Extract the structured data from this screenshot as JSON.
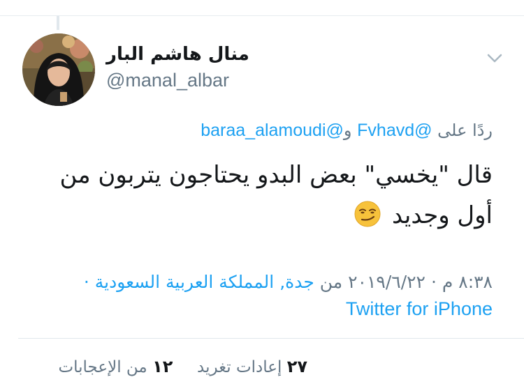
{
  "tweet": {
    "author": {
      "display_name": "منال هاشم البار",
      "handle": "@manal_albar"
    },
    "reply": {
      "prefix": "ردًا على",
      "mention_1": "@Fvhavd",
      "joiner": "و",
      "mention_2": "@baraa_alamoudi"
    },
    "text_line_1": "قال \"يخسي\" بعض البدو يحتاجون يتربون من",
    "text_line_2": "أول وجديد",
    "emoji": "smirking-face-emoji",
    "meta": {
      "time": "٨:٣٨ م",
      "separator": "·",
      "date": "٢٠١٩/٦/٢٢",
      "from": "من",
      "location": "جدة, المملكة العربية السعودية",
      "separator_2": "·",
      "source": "Twitter for iPhone"
    },
    "stats": {
      "retweets_count": "٢٧",
      "retweets_label": "إعادات تغريد",
      "likes_count": "١٢",
      "likes_label": "من الإعجابات"
    }
  },
  "colors": {
    "link": "#1da1f2",
    "muted": "#657786",
    "text": "#14171a",
    "divider": "#e1e8ed"
  },
  "icons": {
    "menu": "chevron-down-icon",
    "avatar": "profile-photo"
  }
}
